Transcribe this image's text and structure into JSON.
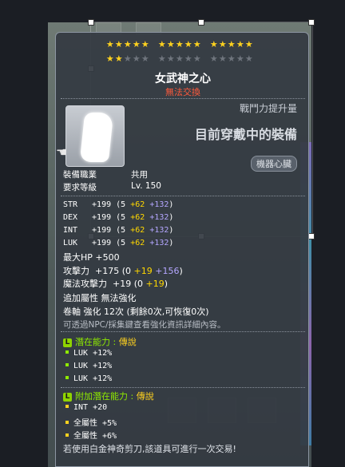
{
  "stars": {
    "row1": [
      1,
      1,
      1,
      1,
      1,
      1,
      1,
      1,
      1,
      1,
      1,
      1,
      1,
      1,
      1
    ],
    "row2": [
      1,
      1,
      0,
      0,
      0,
      0,
      0,
      0,
      0,
      0,
      0,
      0,
      0,
      0,
      0
    ]
  },
  "item": {
    "name": "女武神之心",
    "trade": "無法交換",
    "power_label": "戰鬥力提升量",
    "equipped_text": "目前穿戴中的裝備",
    "heart_badge": "機器心臟"
  },
  "requirements": {
    "job_label": "裝備職業",
    "job_value": "共用",
    "level_label": "要求等級",
    "level_value": "Lv. 150"
  },
  "stats": [
    {
      "name": "STR",
      "total": "+199",
      "base": "(5",
      "bonus": "+62",
      "star": "+132",
      "close": ")"
    },
    {
      "name": "DEX",
      "total": "+199",
      "base": "(5",
      "bonus": "+62",
      "star": "+132",
      "close": ")"
    },
    {
      "name": "INT",
      "total": "+199",
      "base": "(5",
      "bonus": "+62",
      "star": "+132",
      "close": ")"
    },
    {
      "name": "LUK",
      "total": "+199",
      "base": "(5",
      "bonus": "+62",
      "star": "+132",
      "close": ")"
    }
  ],
  "hp_line": "最大HP  +500",
  "attack": {
    "label": "攻擊力",
    "total": "+175",
    "base": "(0",
    "bonus": "+19",
    "star": "+156",
    "close": ")"
  },
  "magic": {
    "label": "魔法攻擊力",
    "total": "+19",
    "base": "(0",
    "bonus": "+19",
    "close": ")"
  },
  "extra_line": "追加屬性  無法強化",
  "scroll_line": "卷軸 強化 12次 (剩餘0次,可恢復0次)",
  "npc_line": "可透過NPC/採集鍵查看強化資訊詳細內容。",
  "potential": {
    "badge": "L",
    "label": "潛在能力 :",
    "grade": "傳說",
    "lines": [
      "LUK +12%",
      "LUK +12%",
      "LUK +12%"
    ]
  },
  "bonus_potential": {
    "badge": "L",
    "label": "附加潛在能力 :",
    "grade": "傳說",
    "lines": [
      "INT +20",
      "全屬性 +5%",
      "全屬性 +6%"
    ]
  },
  "footer": "若使用白金神奇剪刀,該道具可進行一次交易!",
  "colors": {
    "accent_yellow": "#ffd700",
    "accent_blue": "#b4a6ff",
    "legend_green": "#8fea00",
    "trade_red": "#ff5a3c"
  }
}
